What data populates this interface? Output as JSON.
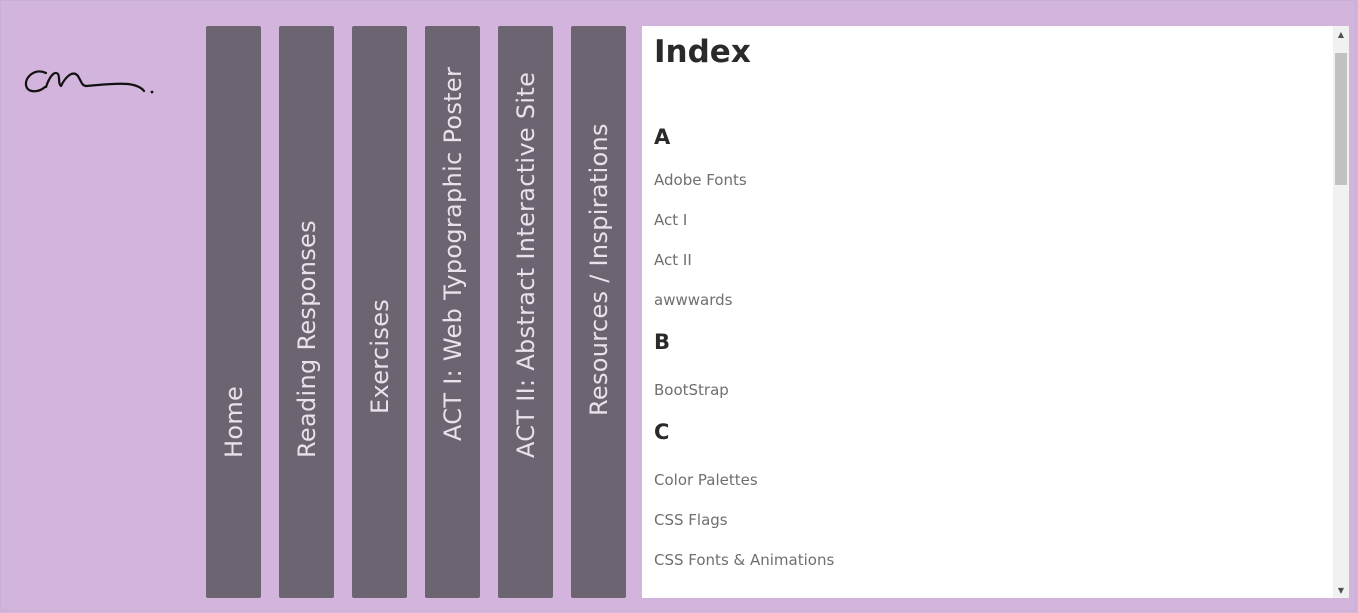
{
  "logo": {
    "alt": "signature logo"
  },
  "nav": {
    "items": [
      {
        "label": "Home"
      },
      {
        "label": "Reading Responses"
      },
      {
        "label": "Exercises"
      },
      {
        "label": "ACT I: Web Typographic Poster"
      },
      {
        "label": "ACT II: Abstract Interactive Site"
      },
      {
        "label": "Resources / Inspirations"
      }
    ]
  },
  "content": {
    "title": "Index",
    "sections": [
      {
        "letter": "A",
        "links": [
          "Adobe Fonts",
          "Act I",
          "Act II",
          "awwwards"
        ]
      },
      {
        "letter": "B",
        "links": [
          "BootStrap"
        ]
      },
      {
        "letter": "C",
        "links": [
          "Color Palettes",
          "CSS Flags",
          "CSS Fonts & Animations"
        ]
      }
    ]
  },
  "scrollbar": {
    "up_icon": "▲",
    "down_icon": "▼"
  },
  "colors": {
    "background": "#d2b4dc",
    "nav_tab": "#6c6470",
    "nav_text": "#e8e2ea",
    "content_bg": "#ffffff"
  }
}
